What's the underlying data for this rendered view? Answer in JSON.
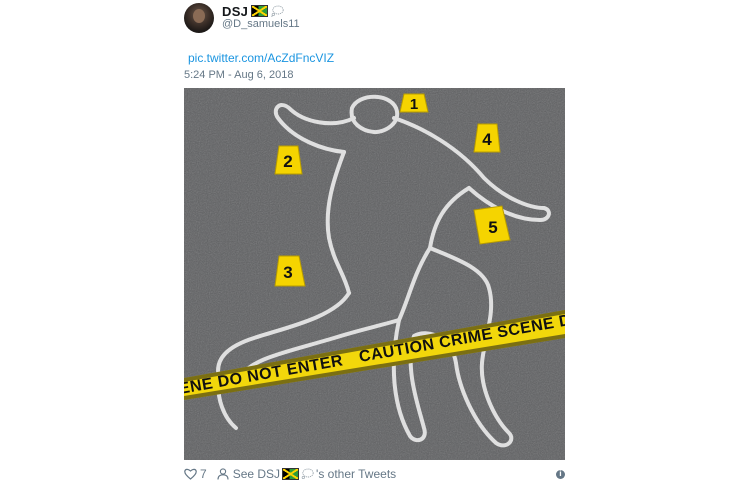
{
  "tweet": {
    "display_name": "DSJ",
    "handle": "@D_samuels11",
    "link_text": "pic.twitter.com/AcZdFncVIZ",
    "timestamp": "5:24 PM - Aug 6, 2018",
    "like_count": "7",
    "see_prefix": "See DSJ",
    "see_suffix": "'s other Tweets",
    "info_glyph": "i"
  },
  "photo": {
    "markers": [
      "1",
      "2",
      "3",
      "4",
      "5"
    ],
    "tape_text": "CAUTION CRIME SCENE DO",
    "tape_text_left": "ENE DO NOT ENTER"
  },
  "colors": {
    "link": "#1b95e0",
    "secondary_text": "#657786",
    "tape_yellow": "#f2d70b",
    "marker_yellow": "#f5d400",
    "asphalt": "#5e5f61"
  }
}
